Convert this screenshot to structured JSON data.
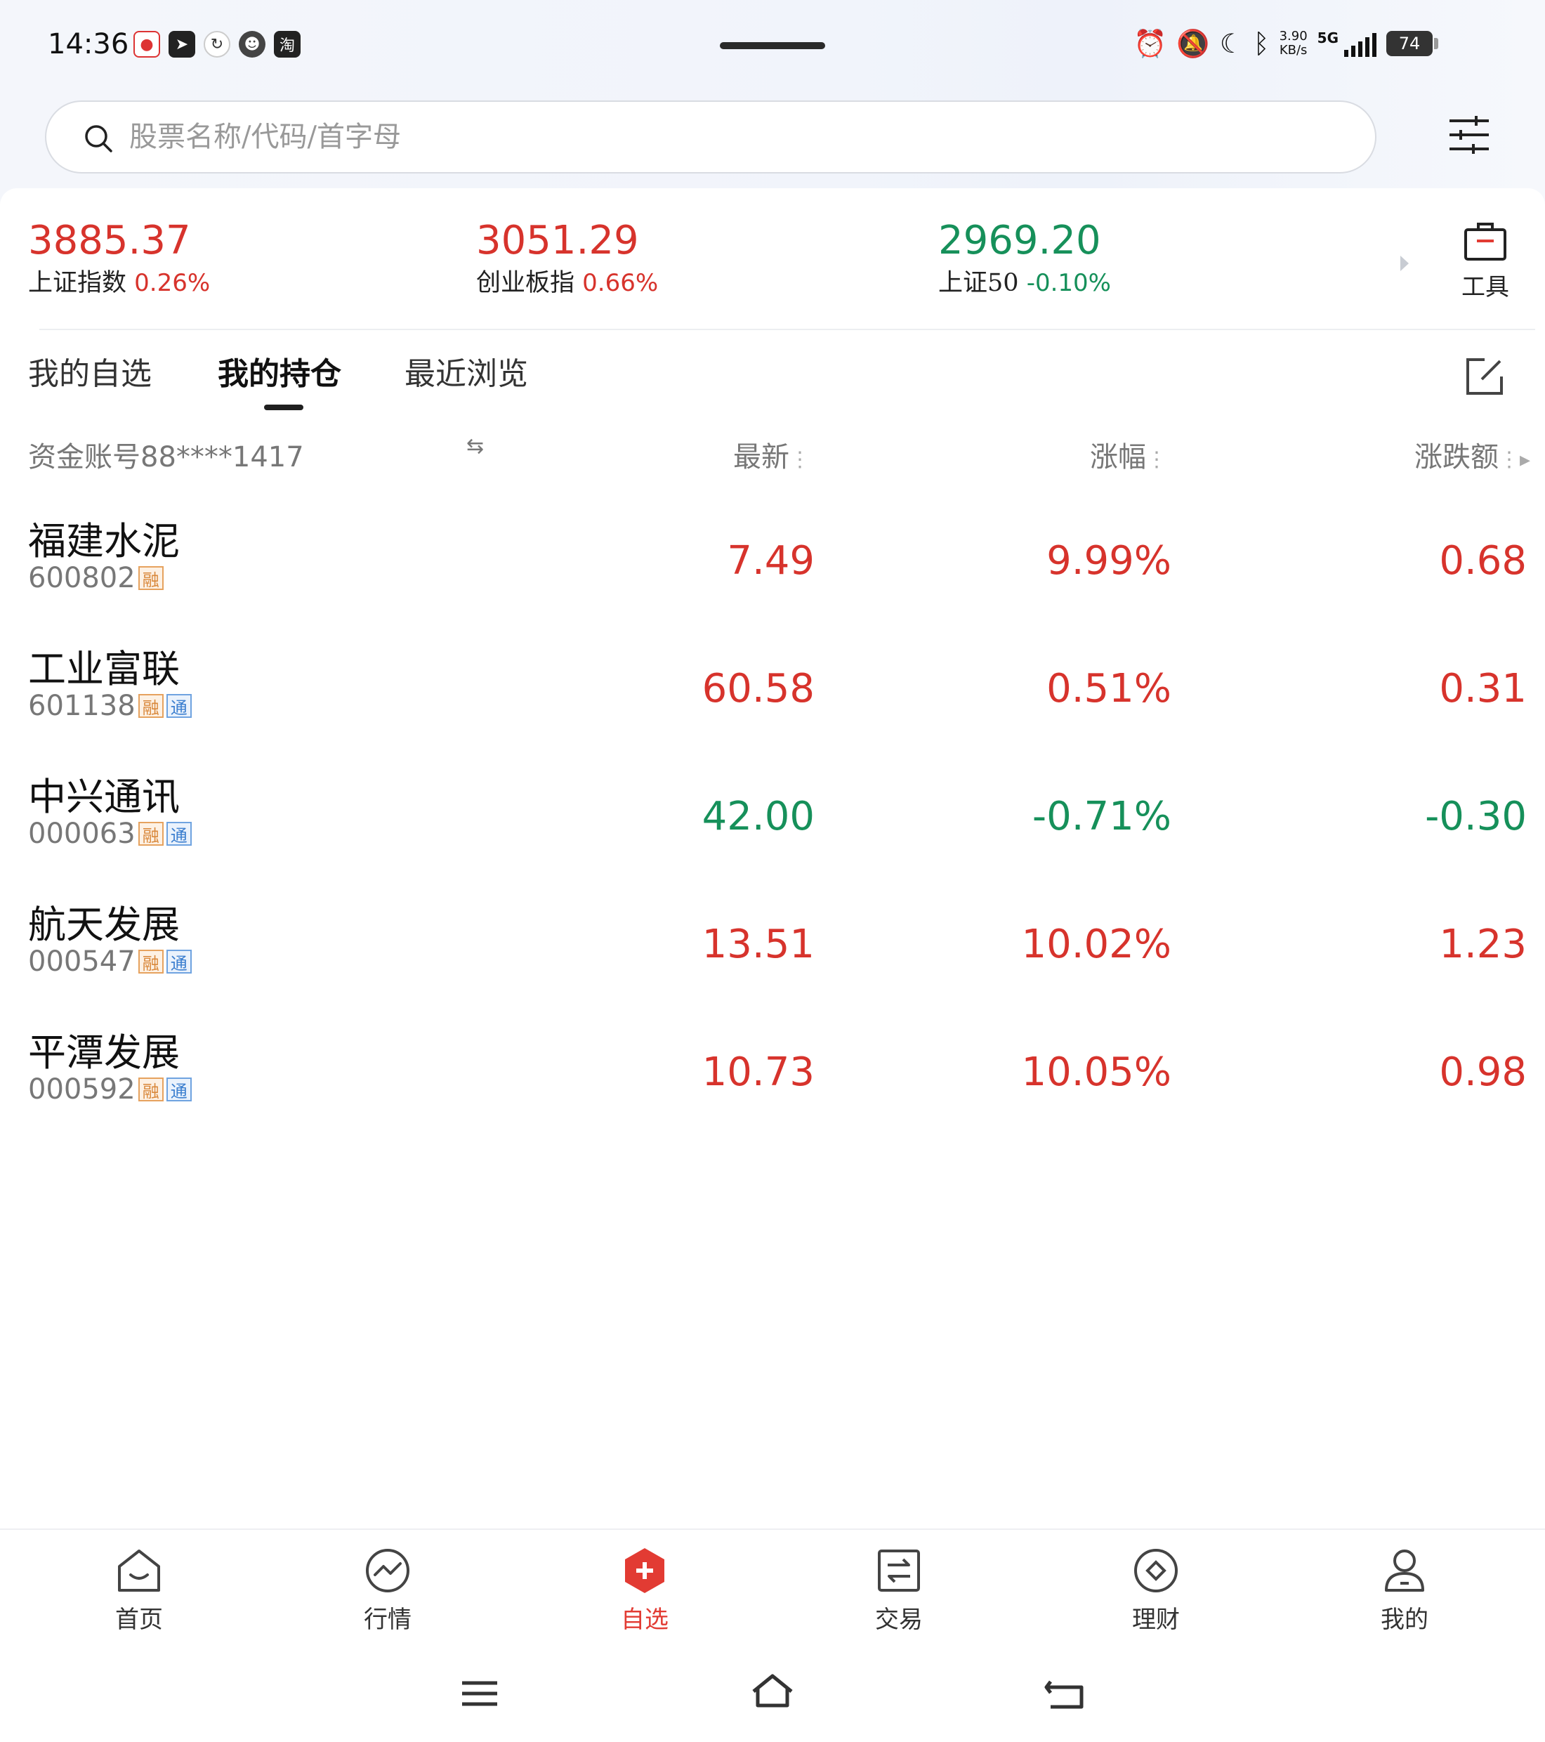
{
  "status_bar": {
    "time": "14:36",
    "net_speed_value": "3.90",
    "net_speed_unit": "KB/s",
    "network": "5G",
    "battery": "74",
    "app_icons": [
      "lottery-app-icon",
      "telegram-icon",
      "vpn-icon",
      "avatar-app-icon",
      "taobao-icon"
    ],
    "taobao_glyph": "淘"
  },
  "search": {
    "placeholder": "股票名称/代码/首字母"
  },
  "indices": [
    {
      "value": "3885.37",
      "name": "上证指数",
      "change": "0.26%",
      "direction": "up"
    },
    {
      "value": "3051.29",
      "name": "创业板指",
      "change": "0.66%",
      "direction": "up"
    },
    {
      "value": "2969.20",
      "name": "上证50",
      "change": "-0.10%",
      "direction": "down"
    }
  ],
  "tools": {
    "label": "工具"
  },
  "tabs": [
    {
      "label": "我的自选",
      "active": false
    },
    {
      "label": "我的持仓",
      "active": true
    },
    {
      "label": "最近浏览",
      "active": false
    }
  ],
  "table": {
    "account": "资金账号88****1417",
    "headers": {
      "latest": "最新",
      "change_pct": "涨幅",
      "change_amount": "涨跌额"
    },
    "rows": [
      {
        "name": "福建水泥",
        "code": "600802",
        "tags": [
          "融"
        ],
        "latest": "7.49",
        "pct": "9.99%",
        "chg": "0.68",
        "direction": "up"
      },
      {
        "name": "工业富联",
        "code": "601138",
        "tags": [
          "融",
          "通"
        ],
        "latest": "60.58",
        "pct": "0.51%",
        "chg": "0.31",
        "direction": "up"
      },
      {
        "name": "中兴通讯",
        "code": "000063",
        "tags": [
          "融",
          "通"
        ],
        "latest": "42.00",
        "pct": "-0.71%",
        "chg": "-0.30",
        "direction": "down"
      },
      {
        "name": "航天发展",
        "code": "000547",
        "tags": [
          "融",
          "通"
        ],
        "latest": "13.51",
        "pct": "10.02%",
        "chg": "1.23",
        "direction": "up"
      },
      {
        "name": "平潭发展",
        "code": "000592",
        "tags": [
          "融",
          "通"
        ],
        "latest": "10.73",
        "pct": "10.05%",
        "chg": "0.98",
        "direction": "up"
      }
    ]
  },
  "bottom_nav": [
    {
      "label": "首页",
      "icon": "home-icon",
      "active": false
    },
    {
      "label": "行情",
      "icon": "market-icon",
      "active": false
    },
    {
      "label": "自选",
      "icon": "watchlist-icon",
      "active": true
    },
    {
      "label": "交易",
      "icon": "trade-icon",
      "active": false
    },
    {
      "label": "理财",
      "icon": "wealth-icon",
      "active": false
    },
    {
      "label": "我的",
      "icon": "profile-icon",
      "active": false
    }
  ],
  "colors": {
    "up": "#d7332c",
    "down": "#16905a",
    "accent": "#e23b33"
  }
}
